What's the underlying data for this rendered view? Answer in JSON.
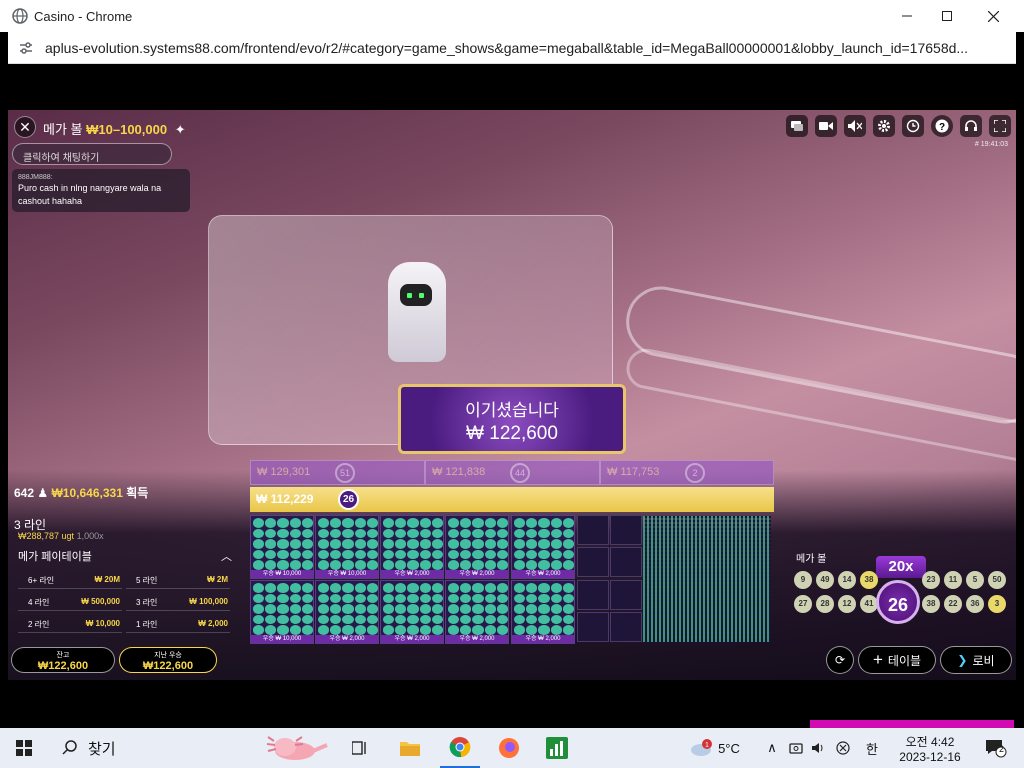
{
  "window": {
    "title": "Casino - Chrome"
  },
  "address": {
    "url": "aplus-evolution.systems88.com/frontend/evo/r2/#category=game_shows&game=megaball&table_id=MegaBall00000001&lobby_launch_id=17658d..."
  },
  "header": {
    "game_name": "메가 볼",
    "limits": "₩10–100,000",
    "round_id": "# 19:41:03"
  },
  "chat": {
    "placeholder": "클릭하여 채팅하기",
    "user": "888JM888:",
    "message": "Puro cash in nlng nangyare wala na cashout hahaha"
  },
  "win": {
    "title": "이기셨습니다",
    "amount": "₩ 122,600"
  },
  "prev_results": [
    {
      "amount": "₩ 129,301",
      "ball": "51"
    },
    {
      "amount": "₩ 121,838",
      "ball": "44"
    },
    {
      "amount": "₩ 117,753",
      "ball": "2"
    }
  ],
  "current_result": {
    "amount": "₩ 112,229",
    "ball": "26"
  },
  "stats": {
    "players": "642",
    "won": "₩10,646,331",
    "won_label": "획득"
  },
  "lines": {
    "label": "3 라인",
    "odds": "₩288,787 ugt",
    "multiplier": "1,000x"
  },
  "paytable": {
    "title": "메가 페이테이블",
    "rows": [
      {
        "label": "6+ 라인",
        "value": "₩ 20M"
      },
      {
        "label": "5 라인",
        "value": "₩ 2M"
      },
      {
        "label": "4 라인",
        "value": "₩ 500,000"
      },
      {
        "label": "3 라인",
        "value": "₩ 100,000"
      },
      {
        "label": "2 라인",
        "value": "₩ 10,000"
      },
      {
        "label": "1 라인",
        "value": "₩ 2,000"
      }
    ]
  },
  "balance": {
    "label": "잔고",
    "value": "₩122,600"
  },
  "last_win": {
    "label": "지난 우승",
    "value": "₩122,600"
  },
  "cards": [
    {
      "label": "우승 ₩ 10,000"
    },
    {
      "label": "우승 ₩ 10,000"
    },
    {
      "label": "우승 ₩ 2,000"
    },
    {
      "label": "우승 ₩ 2,000"
    },
    {
      "label": "우승 ₩ 2,000"
    },
    {
      "label": "우승 ₩ 10,000"
    },
    {
      "label": "우승 ₩ 2,000"
    },
    {
      "label": "우승 ₩ 2,000"
    },
    {
      "label": "우승 ₩ 2,000"
    },
    {
      "label": "우승 ₩ 2,000"
    }
  ],
  "mega_ball": {
    "title": "메가 볼",
    "multiplier": "20x",
    "main": "26",
    "left_balls": [
      "9",
      "49",
      "14",
      "38",
      "27",
      "28",
      "12",
      "41"
    ],
    "right_balls": [
      "23",
      "11",
      "5",
      "50",
      "38",
      "22",
      "36",
      "3"
    ]
  },
  "buttons": {
    "table": "테이블",
    "lobby": "로비"
  },
  "taskbar": {
    "search": "찾기",
    "weather": "5°C",
    "ime": "한",
    "time": "오전 4:42",
    "date": "2023-12-16",
    "notif": "2"
  }
}
